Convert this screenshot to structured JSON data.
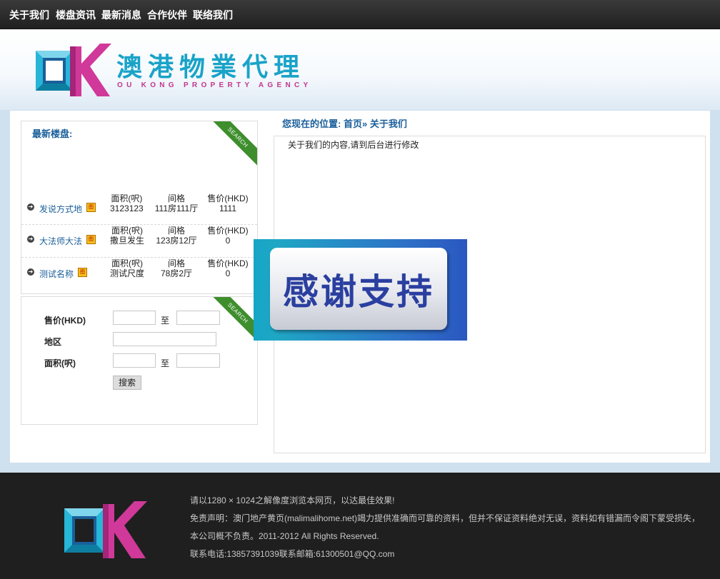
{
  "nav": {
    "items": [
      {
        "label": "关于我们"
      },
      {
        "label": "楼盘资讯"
      },
      {
        "label": "最新消息"
      },
      {
        "label": "合作伙伴"
      },
      {
        "label": "联络我们"
      }
    ]
  },
  "header": {
    "logo_cn": "澳港物業代理",
    "logo_en": "OU KONG PROPERTY AGENCY"
  },
  "latest": {
    "title": "最新楼盘:",
    "ribbon": "SEARCH",
    "items": [
      {
        "name": "发说方式地",
        "area_label": "面积(呎)",
        "area": "3123123",
        "layout_label": "间格",
        "layout": "111房111厅",
        "price_label": "售价(HKD)",
        "price": "1111"
      },
      {
        "name": "大法师大法",
        "area_label": "面积(呎)",
        "area": "撒旦发生",
        "layout_label": "间格",
        "layout": "123房12厅",
        "price_label": "售价(HKD)",
        "price": "0"
      },
      {
        "name": "测试名称",
        "area_label": "面积(呎)",
        "area": "测试尺度",
        "layout_label": "间格",
        "layout": "78房2厅",
        "price_label": "售价(HKD)",
        "price": "0"
      }
    ]
  },
  "search_form": {
    "ribbon": "SEARCH",
    "price_label": "售价(HKD)",
    "district_label": "地区",
    "area_label": "面积(呎)",
    "to": "至",
    "button": "搜索"
  },
  "breadcrumb": {
    "prefix": "您现在的位置:",
    "home": "首页",
    "sep": "»",
    "current": "关于我们"
  },
  "content": {
    "text": "关于我们的内容,请到后台进行修改"
  },
  "popup": {
    "text": "感谢支持"
  },
  "footer": {
    "line1": "请以1280 × 1024之解像度浏览本网页，以达最佳效果!",
    "line2": "免责声明：澳门地产黄页(malimalihome.net)竭力提供准确而可靠的资料，但并不保证资料绝对无误，资料如有错漏而令阁下蒙受损失，",
    "line3": "本公司概不负责。2011-2012 All Rights Reserved.",
    "line4": "联系电话:13857391039联系邮箱:61300501@QQ.com"
  },
  "colors": {
    "brand_cyan": "#1aa3c8",
    "brand_magenta": "#c2368e",
    "link_blue": "#1a5f9a",
    "ribbon_green": "#3e8e2d"
  }
}
